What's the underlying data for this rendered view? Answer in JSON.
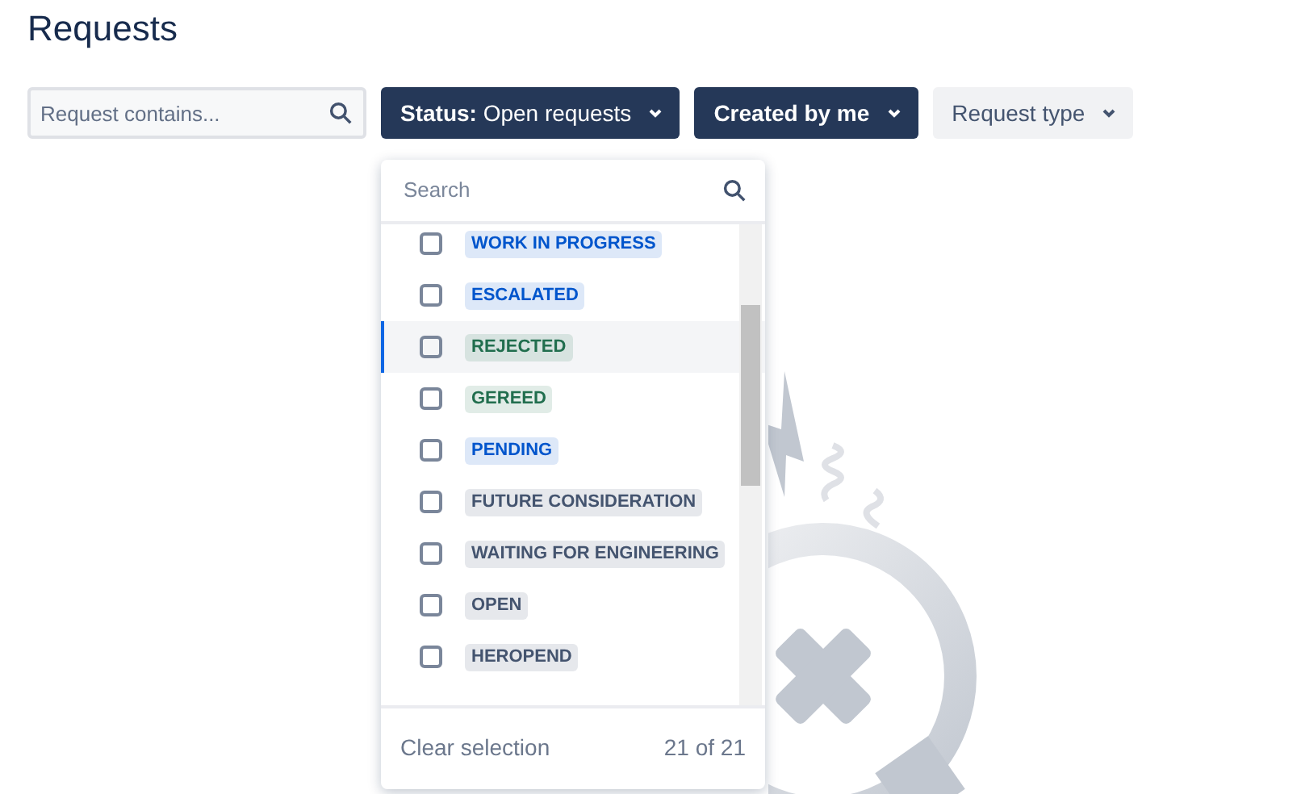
{
  "page_title": "Requests",
  "filters": {
    "search": {
      "placeholder": "Request contains..."
    },
    "buttons": [
      {
        "kind": "dark",
        "label_bold": "Status:",
        "label": "Open requests"
      },
      {
        "kind": "dark",
        "label_bold": "Created by me"
      },
      {
        "kind": "light",
        "label": "Request type"
      }
    ]
  },
  "status_dropdown": {
    "search": {
      "placeholder": "Search"
    },
    "options": [
      {
        "label": "WORK IN PROGRESS",
        "color": "#0055cc",
        "checked": false,
        "highlighted": false
      },
      {
        "label": "ESCALATED",
        "color": "#0055cc",
        "checked": false,
        "highlighted": false
      },
      {
        "label": "REJECTED",
        "color": "#216e4e",
        "checked": false,
        "highlighted": true
      },
      {
        "label": "GEREED",
        "color": "#216e4e",
        "checked": false,
        "highlighted": false
      },
      {
        "label": "PENDING",
        "color": "#0055cc",
        "checked": false,
        "highlighted": false
      },
      {
        "label": "FUTURE CONSIDERATION",
        "color": "#44546f",
        "checked": false,
        "highlighted": false
      },
      {
        "label": "WAITING FOR ENGINEERING",
        "color": "#44546f",
        "checked": false,
        "highlighted": false
      },
      {
        "label": "OPEN",
        "color": "#44546f",
        "checked": false,
        "highlighted": false
      },
      {
        "label": "HEROPEND",
        "color": "#44546f",
        "checked": false,
        "highlighted": false
      }
    ],
    "clear_label": "Clear selection",
    "count": "21 of 21"
  }
}
